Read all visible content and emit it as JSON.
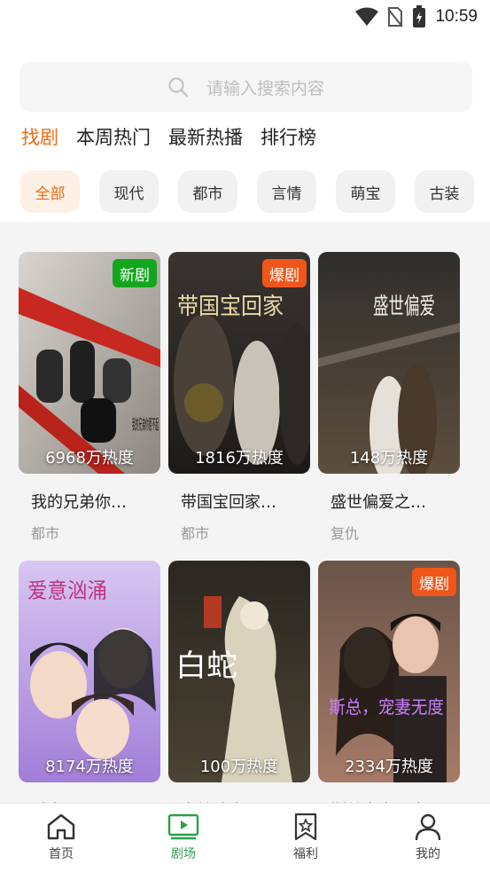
{
  "status_bar": {
    "time": "10:59",
    "icons": [
      "wifi-icon",
      "no-sim-icon",
      "battery-charging-icon"
    ]
  },
  "search": {
    "placeholder": "请输入搜索内容",
    "icon": "search-icon"
  },
  "tabs": [
    {
      "label": "找剧",
      "active": true
    },
    {
      "label": "本周热门",
      "active": false
    },
    {
      "label": "最新热播",
      "active": false
    },
    {
      "label": "排行榜",
      "active": false
    }
  ],
  "categories": [
    {
      "label": "全部",
      "active": true
    },
    {
      "label": "现代",
      "active": false
    },
    {
      "label": "都市",
      "active": false
    },
    {
      "label": "言情",
      "active": false
    },
    {
      "label": "萌宝",
      "active": false
    },
    {
      "label": "古装",
      "active": false
    }
  ],
  "dramas": [
    {
      "title": "我的兄弟你…",
      "genre": "都市",
      "heat": "6968万热度",
      "badge": "新剧",
      "poster_text": "我的兄弟你惹不起"
    },
    {
      "title": "带国宝回家…",
      "genre": "都市",
      "heat": "1816万热度",
      "badge": "爆剧",
      "poster_text": "带国宝回家"
    },
    {
      "title": "盛世偏爱之…",
      "genre": "复仇",
      "heat": "148万热度",
      "badge": "",
      "poster_text": "盛世偏爱"
    },
    {
      "title": "爱意汹涌",
      "genre": "",
      "heat": "8174万热度",
      "badge": "",
      "poster_text": "爱意汹涌"
    },
    {
      "title": "白蛇渡生",
      "genre": "",
      "heat": "100万热度",
      "badge": "",
      "poster_text": "白蛇"
    },
    {
      "title": "斯总宠妻无度",
      "genre": "",
      "heat": "2334万热度",
      "badge": "爆剧",
      "poster_text": "斯总，宠妻无度"
    }
  ],
  "bottom_nav": [
    {
      "label": "首页",
      "icon": "home-icon",
      "active": false
    },
    {
      "label": "剧场",
      "icon": "tv-play-icon",
      "active": true
    },
    {
      "label": "福利",
      "icon": "star-bookmark-icon",
      "active": false
    },
    {
      "label": "我的",
      "icon": "user-icon",
      "active": false
    }
  ],
  "colors": {
    "accent": "#f06a12",
    "nav_active": "#2aa04c",
    "badge_new": "#12a61d",
    "badge_hot": "#f0561a"
  }
}
